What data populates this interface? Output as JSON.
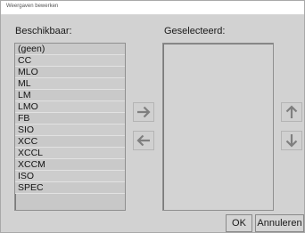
{
  "window": {
    "title": "Weergaven bewerken"
  },
  "labels": {
    "available": "Beschikbaar:",
    "selected": "Geselecteerd:"
  },
  "available_items": [
    {
      "label": "(geen)"
    },
    {
      "label": "CC"
    },
    {
      "label": "MLO"
    },
    {
      "label": "ML"
    },
    {
      "label": "LM"
    },
    {
      "label": "LMO"
    },
    {
      "label": "FB"
    },
    {
      "label": "SIO"
    },
    {
      "label": "XCC"
    },
    {
      "label": "XCCL"
    },
    {
      "label": "XCCM"
    },
    {
      "label": "ISO"
    },
    {
      "label": "SPEC"
    }
  ],
  "selected_items": [],
  "buttons": {
    "ok": "OK",
    "cancel": "Annuleren"
  },
  "icons": {
    "add": "arrow-right-icon",
    "remove": "arrow-left-icon",
    "move_up": "arrow-up-icon",
    "move_down": "arrow-down-icon"
  },
  "colors": {
    "arrow": "#7f7f7f",
    "background": "#d2d2d2",
    "list_bg": "#c9c9c9"
  }
}
